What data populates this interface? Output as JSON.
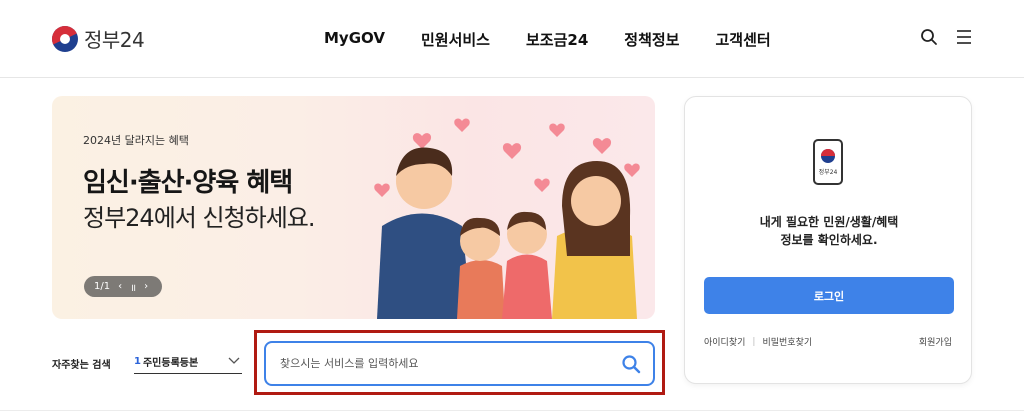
{
  "header": {
    "logo_text": "정부24",
    "nav": [
      "MyGOV",
      "민원서비스",
      "보조금24",
      "정책정보",
      "고객센터"
    ],
    "icons": {
      "search": "search-icon",
      "menu": "hamburger-menu-icon"
    }
  },
  "banner": {
    "subtitle": "2024년 달라지는 혜택",
    "title": "임신·출산·양육 혜택",
    "title2": "정부24에서 신청하세요.",
    "slide_counter": "1/1",
    "controls": {
      "prev": "‹",
      "pause": "॥",
      "next": "›"
    }
  },
  "login": {
    "app_label": "정부24",
    "message_line1": "내게 필요한 민원/생활/혜택",
    "message_line2": "정보를 확인하세요.",
    "login_button": "로그인",
    "find_id": "아이디찾기",
    "find_password": "비밀번호찾기",
    "signup": "회원가입"
  },
  "frequent_search": {
    "label": "자주찾는 검색",
    "selected_rank": "1",
    "selected_value": "주민등록등본"
  },
  "search": {
    "placeholder": "찾으시는 서비스를 입력하세요",
    "value": ""
  },
  "colors": {
    "accent_blue": "#3e82e8",
    "highlight_red": "#b01a12",
    "rank_blue": "#2b63d9"
  }
}
